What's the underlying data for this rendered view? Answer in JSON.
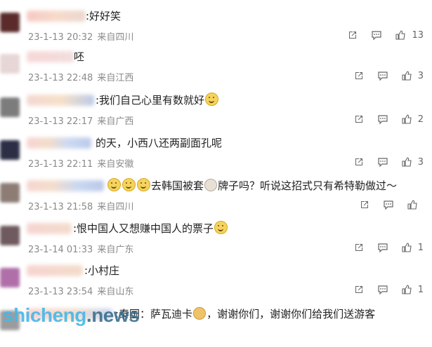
{
  "comments": [
    {
      "text": ":好好笑",
      "date": "23-1-13 20:32",
      "region": "来自四川",
      "likes": "13"
    },
    {
      "text": "呸",
      "date": "23-1-13 22:48",
      "region": "来自江西",
      "likes": "3"
    },
    {
      "text": ":我们自己心里有数就好",
      "date": "23-1-13 22:17",
      "region": "来自广西",
      "likes": "2"
    },
    {
      "text": "的天，小西八还两副面孔呢",
      "date": "23-1-13 22:11",
      "region": "来自安徽",
      "likes": "3"
    },
    {
      "text": "去韩国被套",
      "text2": "牌子吗？听说这招式只有希特勒做过～",
      "date": "23-1-13 21:58",
      "region": "来自四川",
      "likes": ""
    },
    {
      "text": ":恨中国人又想赚中国人的票子",
      "date": "23-1-14 01:33",
      "region": "来自广东",
      "likes": "1"
    },
    {
      "text": ":小村庄",
      "date": "23-1-13 23:54",
      "region": "来自山东",
      "likes": "1"
    },
    {
      "text": ":泰国：萨瓦迪卡",
      "text2": "，谢谢你们，谢谢你们给我们送游客",
      "date": "",
      "region": "",
      "likes": ""
    }
  ],
  "watermark": {
    "part1": "shicheng",
    "part2": ".news"
  },
  "icons": {
    "share": "share-icon",
    "comment": "comment-icon",
    "like": "thumbs-up-icon"
  }
}
